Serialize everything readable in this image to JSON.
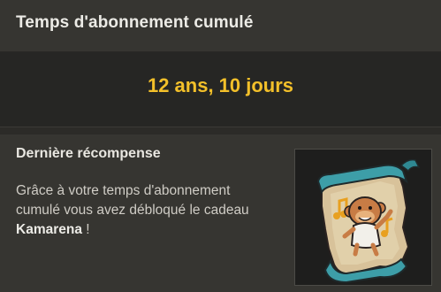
{
  "header": {
    "title": "Temps d'abonnement cumulé"
  },
  "subscription": {
    "total_duration": "12 ans, 10 jours"
  },
  "reward": {
    "title": "Dernière récompense",
    "desc_text": "Grâce à votre temps d'abonnement cumulé vous avez débloqué le cadeau ",
    "gift_name": "Kamarena",
    "desc_end": " !",
    "image_icon": "kamarena-scroll-icon"
  },
  "colors": {
    "accent": "#f3c02a",
    "panel_bg": "#363531",
    "band_bg": "#262624"
  }
}
